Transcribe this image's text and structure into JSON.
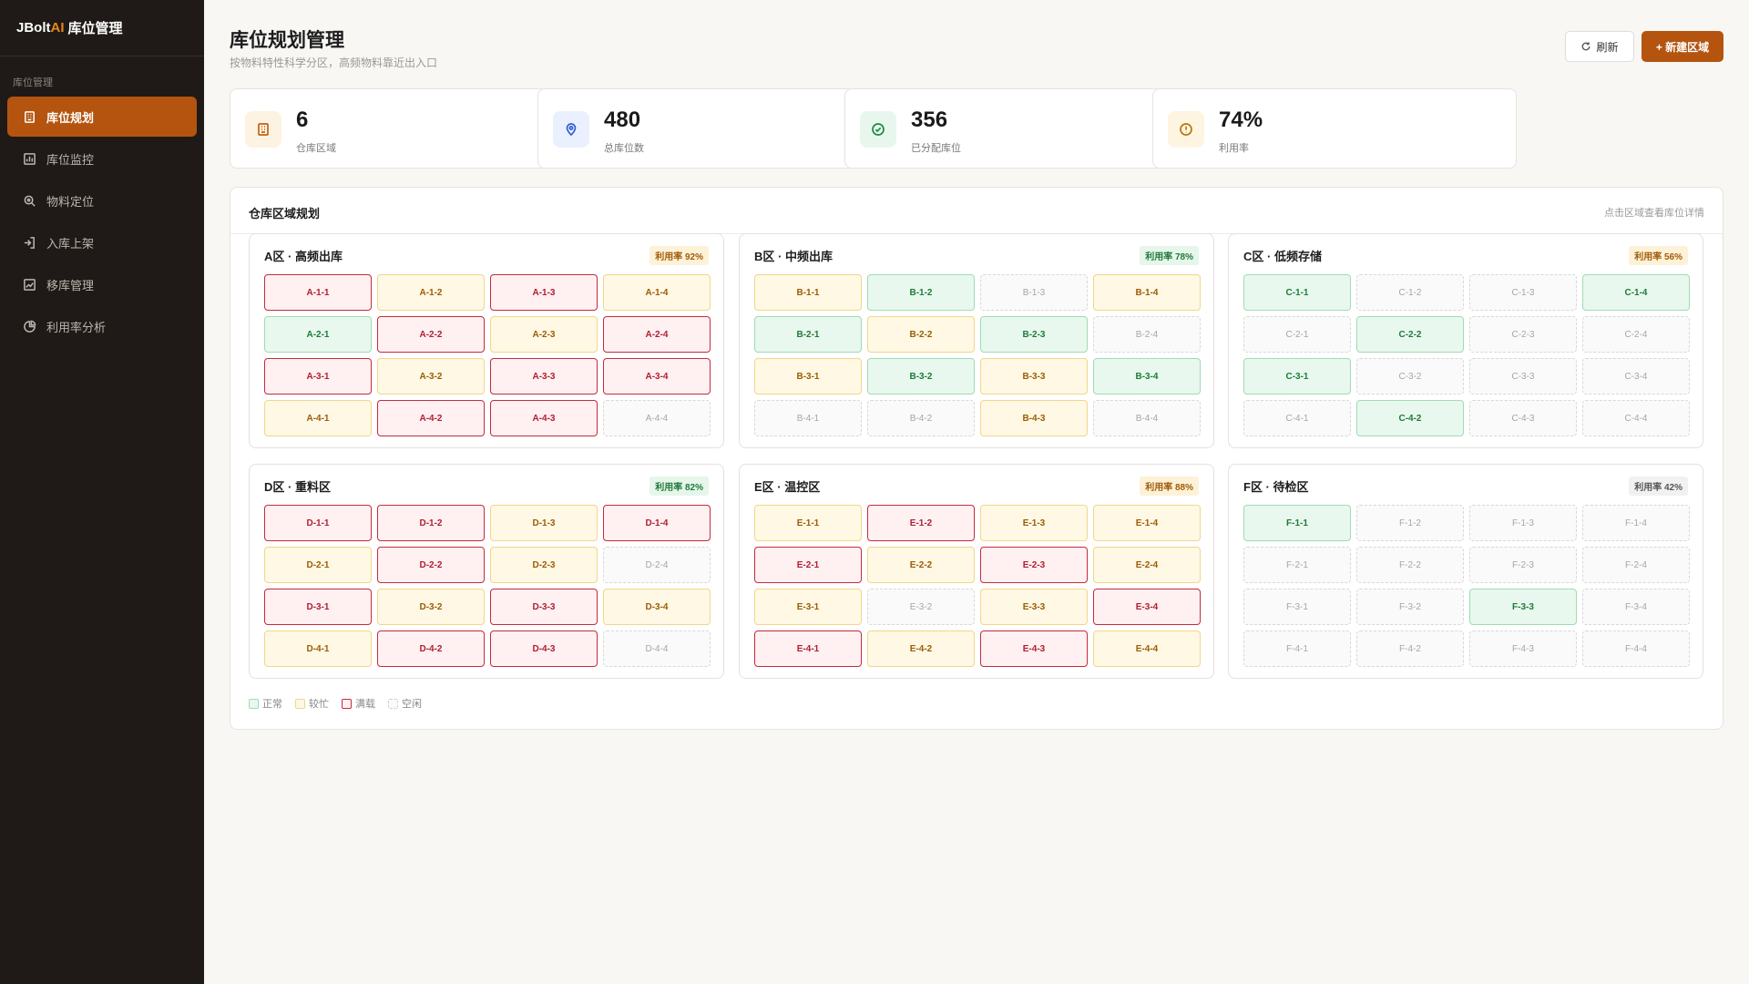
{
  "brand": {
    "name": "JBolt",
    "ai": "AI",
    "rest": "库位管理"
  },
  "sidebar": {
    "section": "库位管理",
    "items": [
      {
        "label": "库位规划",
        "icon": "building-icon",
        "active": true
      },
      {
        "label": "库位监控",
        "icon": "monitor-chart-icon",
        "active": false
      },
      {
        "label": "物料定位",
        "icon": "search-locate-icon",
        "active": false
      },
      {
        "label": "入库上架",
        "icon": "inbound-icon",
        "active": false
      },
      {
        "label": "移库管理",
        "icon": "transfer-chart-icon",
        "active": false
      },
      {
        "label": "利用率分析",
        "icon": "pie-chart-icon",
        "active": false
      }
    ]
  },
  "header": {
    "title": "库位规划管理",
    "subtitle": "按物料特性科学分区，高频物料靠近出入口",
    "refresh_label": "刷新",
    "new_label": "+ 新建区域"
  },
  "stats": [
    {
      "value": "6",
      "label": "仓库区域",
      "icon": "building-icon",
      "color": "#c2620f",
      "bg": "#fdf3e3"
    },
    {
      "value": "480",
      "label": "总库位数",
      "icon": "location-pin-icon",
      "color": "#2f5fd0",
      "bg": "#eaf0fd"
    },
    {
      "value": "356",
      "label": "已分配库位",
      "icon": "check-circle-icon",
      "color": "#1f8a45",
      "bg": "#e8f7ed"
    },
    {
      "value": "74%",
      "label": "利用率",
      "icon": "alert-circle-icon",
      "color": "#b8770a",
      "bg": "#fdf5e2"
    }
  ],
  "panel": {
    "title": "仓库区域规划",
    "hint": "点击区域查看库位详情"
  },
  "zones": [
    {
      "title": "A区 · 高频出库",
      "util": "利用率 92%",
      "util_class": "util-high",
      "cells": [
        [
          "A-1-1",
          "full"
        ],
        [
          "A-1-2",
          "busy"
        ],
        [
          "A-1-3",
          "full"
        ],
        [
          "A-1-4",
          "busy"
        ],
        [
          "A-2-1",
          "normal"
        ],
        [
          "A-2-2",
          "full"
        ],
        [
          "A-2-3",
          "busy"
        ],
        [
          "A-2-4",
          "full"
        ],
        [
          "A-3-1",
          "full"
        ],
        [
          "A-3-2",
          "busy"
        ],
        [
          "A-3-3",
          "full"
        ],
        [
          "A-3-4",
          "full"
        ],
        [
          "A-4-1",
          "busy"
        ],
        [
          "A-4-2",
          "full"
        ],
        [
          "A-4-3",
          "full"
        ],
        [
          "A-4-4",
          "idle"
        ]
      ]
    },
    {
      "title": "B区 · 中频出库",
      "util": "利用率 78%",
      "util_class": "util-mid",
      "cells": [
        [
          "B-1-1",
          "busy"
        ],
        [
          "B-1-2",
          "normal"
        ],
        [
          "B-1-3",
          "idle"
        ],
        [
          "B-1-4",
          "busy"
        ],
        [
          "B-2-1",
          "normal"
        ],
        [
          "B-2-2",
          "busy"
        ],
        [
          "B-2-3",
          "normal"
        ],
        [
          "B-2-4",
          "idle"
        ],
        [
          "B-3-1",
          "busy"
        ],
        [
          "B-3-2",
          "normal"
        ],
        [
          "B-3-3",
          "busy"
        ],
        [
          "B-3-4",
          "normal"
        ],
        [
          "B-4-1",
          "idle"
        ],
        [
          "B-4-2",
          "idle"
        ],
        [
          "B-4-3",
          "busy"
        ],
        [
          "B-4-4",
          "idle"
        ]
      ]
    },
    {
      "title": "C区 · 低频存储",
      "util": "利用率 56%",
      "util_class": "util-high",
      "cells": [
        [
          "C-1-1",
          "normal"
        ],
        [
          "C-1-2",
          "idle"
        ],
        [
          "C-1-3",
          "idle"
        ],
        [
          "C-1-4",
          "normal"
        ],
        [
          "C-2-1",
          "idle"
        ],
        [
          "C-2-2",
          "normal"
        ],
        [
          "C-2-3",
          "idle"
        ],
        [
          "C-2-4",
          "idle"
        ],
        [
          "C-3-1",
          "normal"
        ],
        [
          "C-3-2",
          "idle"
        ],
        [
          "C-3-3",
          "idle"
        ],
        [
          "C-3-4",
          "idle"
        ],
        [
          "C-4-1",
          "idle"
        ],
        [
          "C-4-2",
          "normal"
        ],
        [
          "C-4-3",
          "idle"
        ],
        [
          "C-4-4",
          "idle"
        ]
      ]
    },
    {
      "title": "D区 · 重料区",
      "util": "利用率 82%",
      "util_class": "util-mid",
      "cells": [
        [
          "D-1-1",
          "full"
        ],
        [
          "D-1-2",
          "full"
        ],
        [
          "D-1-3",
          "busy"
        ],
        [
          "D-1-4",
          "full"
        ],
        [
          "D-2-1",
          "busy"
        ],
        [
          "D-2-2",
          "full"
        ],
        [
          "D-2-3",
          "busy"
        ],
        [
          "D-2-4",
          "idle"
        ],
        [
          "D-3-1",
          "full"
        ],
        [
          "D-3-2",
          "busy"
        ],
        [
          "D-3-3",
          "full"
        ],
        [
          "D-3-4",
          "busy"
        ],
        [
          "D-4-1",
          "busy"
        ],
        [
          "D-4-2",
          "full"
        ],
        [
          "D-4-3",
          "full"
        ],
        [
          "D-4-4",
          "idle"
        ]
      ]
    },
    {
      "title": "E区 · 温控区",
      "util": "利用率 88%",
      "util_class": "util-high",
      "cells": [
        [
          "E-1-1",
          "busy"
        ],
        [
          "E-1-2",
          "full"
        ],
        [
          "E-1-3",
          "busy"
        ],
        [
          "E-1-4",
          "busy"
        ],
        [
          "E-2-1",
          "full"
        ],
        [
          "E-2-2",
          "busy"
        ],
        [
          "E-2-3",
          "full"
        ],
        [
          "E-2-4",
          "busy"
        ],
        [
          "E-3-1",
          "busy"
        ],
        [
          "E-3-2",
          "idle"
        ],
        [
          "E-3-3",
          "busy"
        ],
        [
          "E-3-4",
          "full"
        ],
        [
          "E-4-1",
          "full"
        ],
        [
          "E-4-2",
          "busy"
        ],
        [
          "E-4-3",
          "full"
        ],
        [
          "E-4-4",
          "busy"
        ]
      ]
    },
    {
      "title": "F区 · 待检区",
      "util": "利用率 42%",
      "util_class": "util-low",
      "cells": [
        [
          "F-1-1",
          "normal"
        ],
        [
          "F-1-2",
          "idle"
        ],
        [
          "F-1-3",
          "idle"
        ],
        [
          "F-1-4",
          "idle"
        ],
        [
          "F-2-1",
          "idle"
        ],
        [
          "F-2-2",
          "idle"
        ],
        [
          "F-2-3",
          "idle"
        ],
        [
          "F-2-4",
          "idle"
        ],
        [
          "F-3-1",
          "idle"
        ],
        [
          "F-3-2",
          "idle"
        ],
        [
          "F-3-3",
          "normal"
        ],
        [
          "F-3-4",
          "idle"
        ],
        [
          "F-4-1",
          "idle"
        ],
        [
          "F-4-2",
          "idle"
        ],
        [
          "F-4-3",
          "idle"
        ],
        [
          "F-4-4",
          "idle"
        ]
      ]
    }
  ],
  "legend": [
    {
      "label": "正常",
      "status": "normal"
    },
    {
      "label": "较忙",
      "status": "busy"
    },
    {
      "label": "满载",
      "status": "full"
    },
    {
      "label": "空闲",
      "status": "idle"
    }
  ]
}
